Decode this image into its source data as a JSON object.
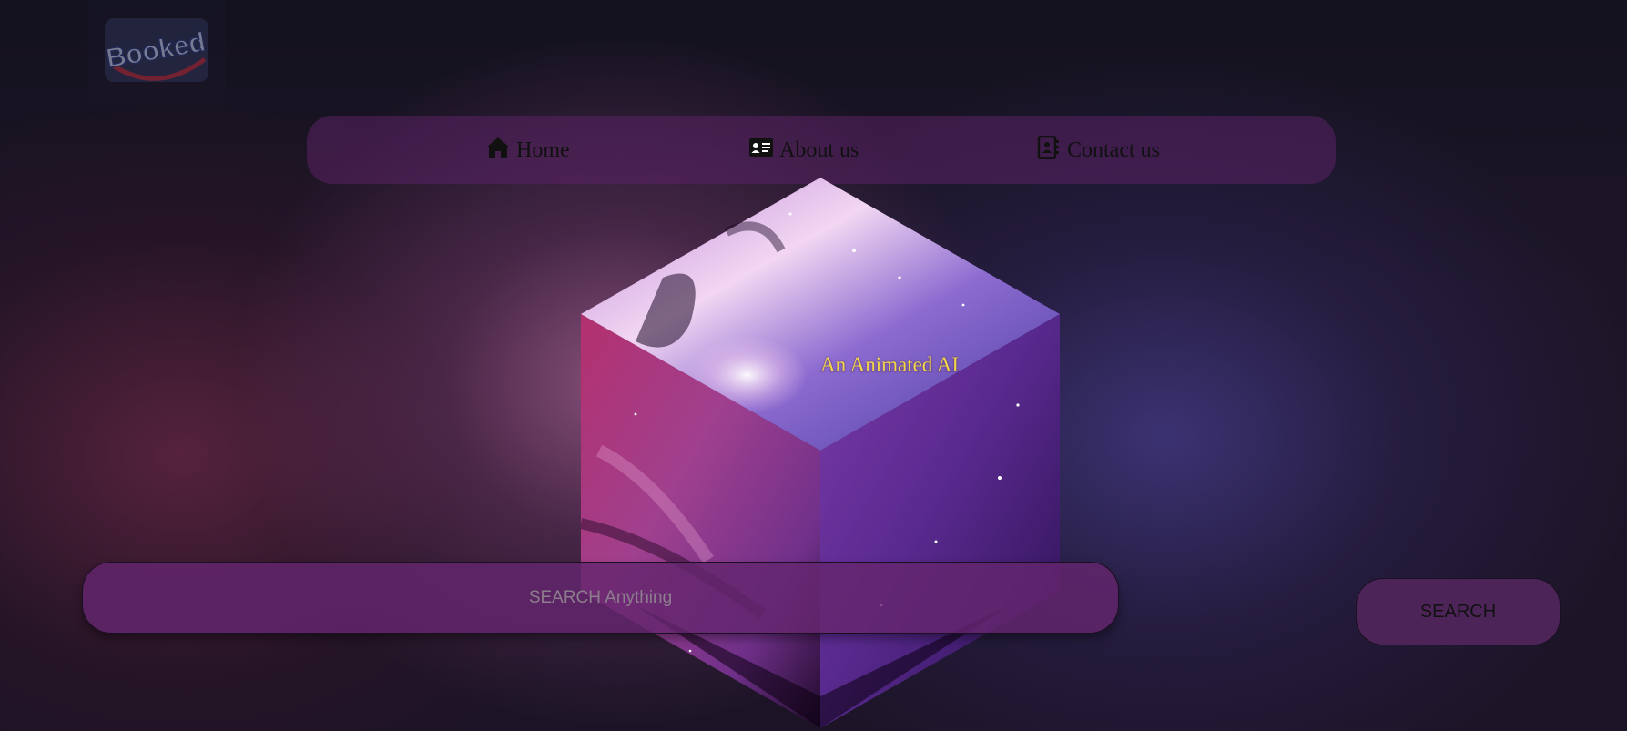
{
  "logo": {
    "text": "Booked",
    "icon": "booked-logo"
  },
  "nav": {
    "items": [
      {
        "label": "Home",
        "icon": "home-icon"
      },
      {
        "label": "About us",
        "icon": "id-card-icon"
      },
      {
        "label": "Contact us",
        "icon": "contact-book-icon"
      }
    ]
  },
  "hero": {
    "caption": "An Animated AI"
  },
  "search": {
    "placeholder": "SEARCH Anything",
    "button_label": "SEARCH"
  },
  "colors": {
    "caption": "#f2d54a",
    "navbar": "#5a2364",
    "search_field": "#64266e",
    "search_button": "#4d2458"
  }
}
